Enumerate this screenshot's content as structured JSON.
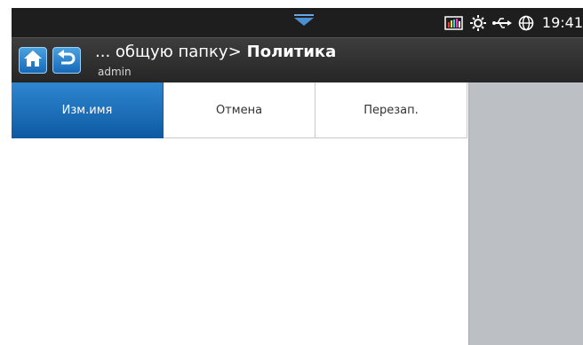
{
  "status_bar": {
    "time": "19:41",
    "icons": [
      "pulldown-arrow-icon",
      "toner-levels-icon",
      "brightness-icon",
      "usb-icon",
      "network-globe-icon"
    ]
  },
  "header": {
    "breadcrumb_path": "... общую папку>",
    "title": "Политика",
    "user": "admin"
  },
  "tabs": [
    {
      "label": "Изм.имя",
      "active": true
    },
    {
      "label": "Отмена",
      "active": false
    },
    {
      "label": "Перезап.",
      "active": false
    }
  ],
  "colors": {
    "accent": "#1769b8",
    "active_tab": "#2f86d0",
    "status_bar": "#1e1e1e",
    "header": "#333333",
    "side_panel": "#bcc0c5"
  }
}
